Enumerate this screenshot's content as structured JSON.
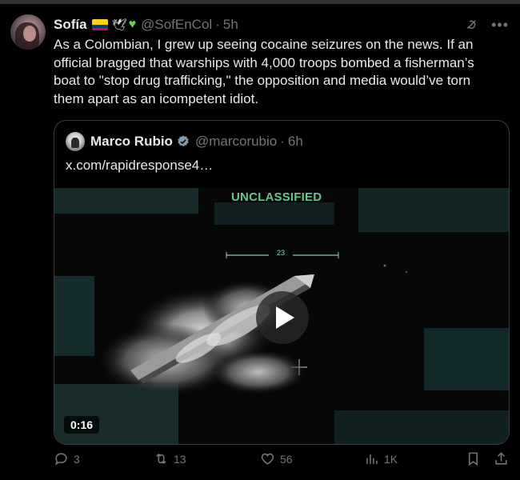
{
  "tweet": {
    "author_name": "Sofía",
    "handle": "@SofEnCol",
    "separator": "·",
    "time": "5h",
    "text": "As a Colombian, I grew up seeing cocaine seizures on the news. If an official bragged that warships with 4,000 troops bombed a fisherman’s boat to \"stop drug trafficking,\" the opposition and media would’ve torn them apart as an icompetent idiot.",
    "icons": {
      "grok": "grok-icon",
      "more": "more-icon",
      "flag": "colombia-flag-icon",
      "dove": "dove-icon",
      "heart": "green-heart-icon"
    }
  },
  "quote": {
    "author_name": "Marco Rubio",
    "handle": "@marcorubio",
    "separator": "·",
    "time": "6h",
    "link": "x.com/rapidresponse4…",
    "video": {
      "overlay_text": "UNCLASSIFIED",
      "reticle_number": "23",
      "duration": "0:16"
    }
  },
  "actions": {
    "replies": "3",
    "reposts": "13",
    "likes": "56",
    "views": "1K"
  },
  "colors": {
    "background": "#000000",
    "text": "#e7e9ea",
    "muted": "#71767b",
    "verified": "#829aab",
    "overlay_green": "#63c88c"
  }
}
